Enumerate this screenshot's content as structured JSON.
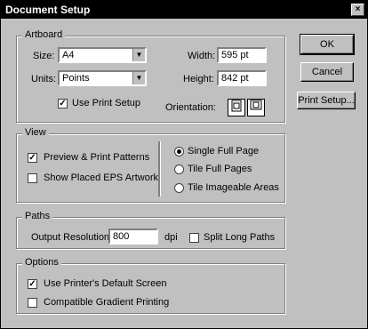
{
  "dialog": {
    "title": "Document Setup",
    "close_glyph": "×"
  },
  "artboard": {
    "legend": "Artboard",
    "size_label": "Size:",
    "size_value": "A4",
    "units_label": "Units:",
    "units_value": "Points",
    "width_label": "Width:",
    "width_value": "595 pt",
    "height_label": "Height:",
    "height_value": "842 pt",
    "use_print_setup": "Use Print Setup",
    "use_print_setup_checked": true,
    "orientation_label": "Orientation:"
  },
  "view": {
    "legend": "View",
    "preview_patterns": "Preview & Print Patterns",
    "preview_patterns_checked": true,
    "show_placed_eps": "Show Placed EPS Artwork",
    "show_placed_eps_checked": false,
    "single_full_page": "Single Full Page",
    "tile_full_pages": "Tile Full Pages",
    "tile_imageable_areas": "Tile Imageable Areas",
    "selected": "single_full_page"
  },
  "paths": {
    "legend": "Paths",
    "output_resolution_label": "Output Resolution:",
    "output_resolution_value": "800",
    "dpi": "dpi",
    "split_long_paths": "Split Long Paths",
    "split_long_paths_checked": false
  },
  "options": {
    "legend": "Options",
    "printers_default_screen": "Use Printer's Default Screen",
    "printers_default_screen_checked": true,
    "compatible_gradient": "Compatible Gradient Printing",
    "compatible_gradient_checked": false
  },
  "buttons": {
    "ok": "OK",
    "cancel": "Cancel",
    "print_setup": "Print Setup..."
  },
  "glyphs": {
    "check": "✓",
    "dropdown": "▼"
  }
}
